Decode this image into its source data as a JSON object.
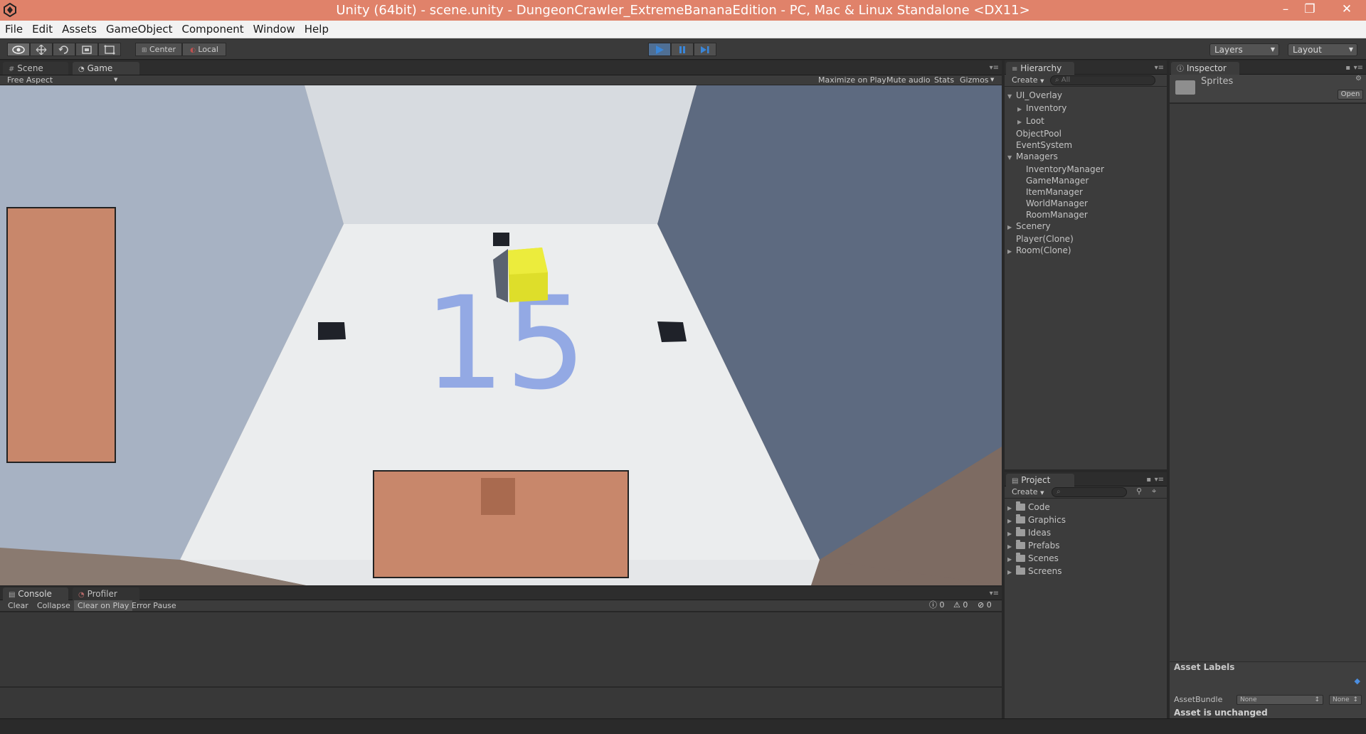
{
  "window": {
    "title": "Unity (64bit) - scene.unity - DungeonCrawler_ExtremeBananaEdition - PC, Mac & Linux Standalone <DX11>",
    "minimize": "–",
    "maximize": "❐",
    "close": "✕"
  },
  "menu": [
    "File",
    "Edit",
    "Assets",
    "GameObject",
    "Component",
    "Window",
    "Help"
  ],
  "toolbar": {
    "pivot_center": "Center",
    "pivot_local": "Local",
    "layers": "Layers",
    "layout": "Layout"
  },
  "scene_tabs": {
    "scene": "Scene",
    "game": "Game"
  },
  "game_bar": {
    "aspect": "Free Aspect",
    "maximize": "Maximize on Play",
    "mute": "Mute audio",
    "stats": "Stats",
    "gizmos": "Gizmos"
  },
  "game_view": {
    "hud_number": "15",
    "colors": {
      "floor": "#ebedee",
      "wall_left": "#a7b2c3",
      "wall_right": "#5d6a80",
      "wall_back": "#d7dbe0",
      "player": "#dede2a",
      "ui_panel": "#c8876b",
      "number": "#93a9e4"
    }
  },
  "hierarchy": {
    "tab": "Hierarchy",
    "create": "Create",
    "search_placeholder": "All",
    "items": [
      {
        "label": "UI_Overlay",
        "expanded": true,
        "indent": 0
      },
      {
        "label": "Inventory",
        "expandable": true,
        "indent": 1
      },
      {
        "label": "Loot",
        "expandable": true,
        "indent": 1
      },
      {
        "label": "ObjectPool",
        "indent": 0
      },
      {
        "label": "EventSystem",
        "indent": 0
      },
      {
        "label": "Managers",
        "expanded": true,
        "indent": 0
      },
      {
        "label": "InventoryManager",
        "indent": 1
      },
      {
        "label": "GameManager",
        "indent": 1
      },
      {
        "label": "ItemManager",
        "indent": 1
      },
      {
        "label": "WorldManager",
        "indent": 1
      },
      {
        "label": "RoomManager",
        "indent": 1
      },
      {
        "label": "Scenery",
        "expandable": true,
        "indent": 0
      },
      {
        "label": "Player(Clone)",
        "indent": 0
      },
      {
        "label": "Room(Clone)",
        "expandable": true,
        "indent": 0
      }
    ]
  },
  "inspector": {
    "tab": "Inspector",
    "asset_name": "Sprites",
    "open_button": "Open",
    "asset_labels": "Asset Labels",
    "asset_bundle_label": "AssetBundle",
    "asset_bundle_value": "None",
    "asset_bundle_variant": "None",
    "status": "Asset is unchanged"
  },
  "project": {
    "tab": "Project",
    "create": "Create",
    "folders": [
      "Code",
      "Graphics",
      "Ideas",
      "Prefabs",
      "Scenes",
      "Screens"
    ]
  },
  "console": {
    "tab_console": "Console",
    "tab_profiler": "Profiler",
    "clear": "Clear",
    "collapse": "Collapse",
    "clear_on_play": "Clear on Play",
    "error_pause": "Error Pause",
    "count_info": "0",
    "count_warn": "0",
    "count_error": "0"
  }
}
